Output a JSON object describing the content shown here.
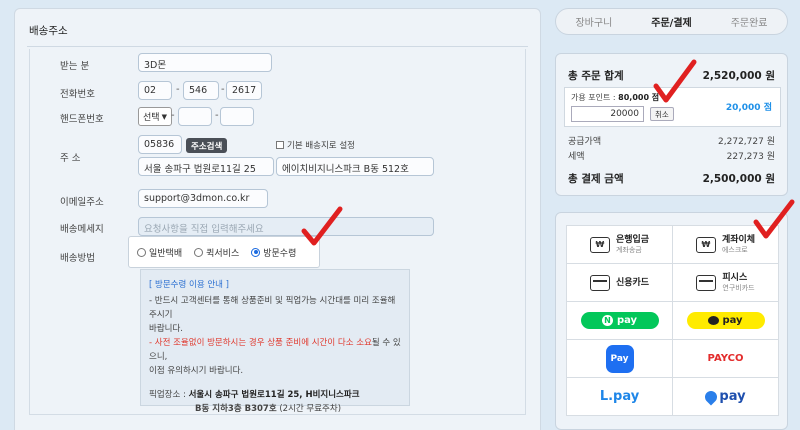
{
  "address": {
    "title": "배송주소",
    "labels": {
      "recipient": "받는 분",
      "phone": "전화번호",
      "mobile": "핸드폰번호",
      "address": "주 소",
      "email": "이메일주소",
      "message": "배송메세지",
      "method": "배송방법"
    },
    "recipient": "3D몬",
    "phone": [
      "02",
      "546",
      "2617"
    ],
    "mobile_select": "선택",
    "zipcode": "05836",
    "search_button": "주소검색",
    "default_checkbox": "기본 배송지로 설정",
    "address1": "서울 송파구 법원로11길 25",
    "address2": "에이치비지니스파크 B동 512호",
    "email": "support@3dmon.co.kr",
    "message_placeholder": "요청사항을 직접 입력해주세요",
    "shipping_options": [
      "일반택배",
      "퀵서비스",
      "방문수령"
    ],
    "shipping_selected": "방문수령"
  },
  "pickup_info": {
    "title": "[ 방문수령 이용 안내 ]",
    "line1": "- 반드시 고객센터를 통해 상품준비 및 픽업가능 시간대를 미리 조율해주시기",
    "line1b": "바랍니다.",
    "line2_red": "- 사전 조율없이 방문하시는 경우 상품 준비에 시간이 다소 소요",
    "line2_rest": "될 수 있으니,",
    "line3": "이점 유의하시기 바랍니다.",
    "pickup_label": "픽업장소 :",
    "pickup_addr1": "서울시 송파구 법원로11길 25, H비지니스파크",
    "pickup_addr2": "B동 지하3층 B307호",
    "pickup_note": "(2시간 무료주차)"
  },
  "steps": [
    "장바구니",
    "주문/결제",
    "주문완료"
  ],
  "summary": {
    "total_label": "총 주문 합계",
    "total_value": "2,520,000 원",
    "point_label": "가용 포인트 :",
    "point_value": "80,000 점",
    "point_input": "20000",
    "cancel_label": "취소",
    "point_applied": "20,000 점",
    "supply_label": "공급가액",
    "supply_value": "2,272,727 원",
    "tax_label": "세액",
    "tax_value": "227,273 원",
    "pay_label": "총 결제 금액",
    "pay_value": "2,500,000 원"
  },
  "payment": {
    "bank": {
      "main": "은행입금",
      "sub": "계좌송금",
      "icon": "won-icon"
    },
    "transfer": {
      "main": "계좌이체",
      "sub": "에스크로",
      "icon": "won-icon"
    },
    "card": {
      "main": "신용카드",
      "icon": "card-icon"
    },
    "pisis": {
      "main": "피시스",
      "sub": "연구비카드",
      "icon": "card-icon"
    },
    "npay": "pay",
    "npay_n": "N",
    "kpay": "pay",
    "spay": "Pay",
    "payco": "PAYCO",
    "lpay": "L.pay",
    "tpay": "pay"
  },
  "colors": {
    "accent_red": "#e02020",
    "link_blue": "#1e90e8",
    "npay_green": "#03c75a",
    "kakao_yellow": "#ffeb00"
  }
}
